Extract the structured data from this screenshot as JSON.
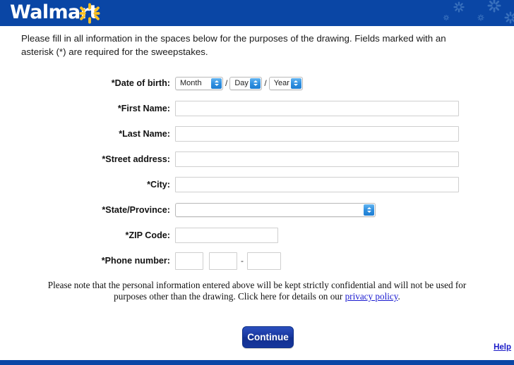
{
  "header": {
    "brand": "Walmart",
    "spark_icon": "spark-starburst-icon",
    "brand_color": "#0a46a5",
    "spark_color": "#ffc220"
  },
  "intro": {
    "text": "Please fill in all information in the spaces below for the purposes of the drawing. Fields marked with an asterisk (*) are required for the sweepstakes."
  },
  "form": {
    "dob": {
      "label": "*Date of birth:",
      "month": {
        "value": "Month"
      },
      "day": {
        "value": "Day"
      },
      "year": {
        "value": "Year"
      },
      "separator": "/"
    },
    "first_name": {
      "label": "*First Name:",
      "value": "",
      "placeholder": ""
    },
    "last_name": {
      "label": "*Last Name:",
      "value": "",
      "placeholder": ""
    },
    "street": {
      "label": "*Street address:",
      "value": "",
      "placeholder": ""
    },
    "city": {
      "label": "*City:",
      "value": "",
      "placeholder": ""
    },
    "state": {
      "label": "*State/Province:",
      "value": ""
    },
    "zip": {
      "label": "*ZIP Code:",
      "value": "",
      "placeholder": ""
    },
    "phone": {
      "label": "*Phone number:",
      "part1": "",
      "part2": "",
      "part3": "",
      "separator": "-"
    }
  },
  "note": {
    "text_before": "Please note that the personal information entered above will be kept strictly confidential and will not be used for purposes other than the drawing. Click here for details on our ",
    "link": "privacy policy",
    "text_after": "."
  },
  "actions": {
    "continue_label": "Continue",
    "help_label": "Help"
  }
}
